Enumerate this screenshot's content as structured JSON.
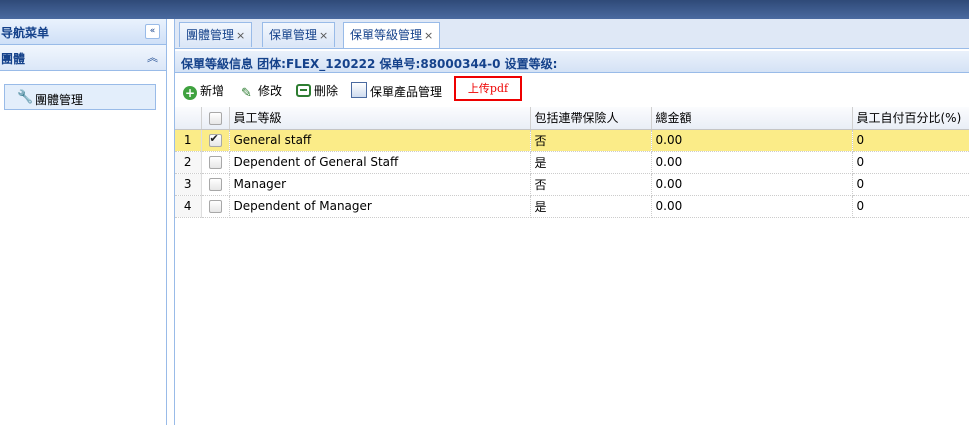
{
  "sidebar": {
    "title": "导航菜单",
    "collapse_icon": "«",
    "section": "團體",
    "section_icon": "︽",
    "items": [
      {
        "label": "團體管理",
        "icon": "wrench-icon"
      }
    ]
  },
  "tabs": [
    {
      "label": "團體管理"
    },
    {
      "label": "保單管理"
    },
    {
      "label": "保單等級管理"
    }
  ],
  "tab_close": "×",
  "panel": {
    "title": "保單等級信息 团体:FLEX_120222 保单号:88000344-0 设置等级:"
  },
  "toolbar": {
    "add": "新增",
    "edit": "修改",
    "delete": "刪除",
    "product": "保單產品管理",
    "upload": "上传pdf"
  },
  "grid": {
    "columns": [
      "員工等級",
      "包括連帶保險人",
      "總金額",
      "員工自付百分比(%)"
    ],
    "rows": [
      {
        "n": "1",
        "checked": true,
        "grade": "General staff",
        "dependent": "否",
        "amount": "0.00",
        "pct": "0"
      },
      {
        "n": "2",
        "checked": false,
        "grade": "Dependent of General Staff",
        "dependent": "是",
        "amount": "0.00",
        "pct": "0"
      },
      {
        "n": "3",
        "checked": false,
        "grade": "Manager",
        "dependent": "否",
        "amount": "0.00",
        "pct": "0"
      },
      {
        "n": "4",
        "checked": false,
        "grade": "Dependent of Manager",
        "dependent": "是",
        "amount": "0.00",
        "pct": "0"
      }
    ]
  },
  "colors": {
    "selected_row": "#fbec88",
    "header_text": "#15428b",
    "upload_border": "#ee0000"
  }
}
